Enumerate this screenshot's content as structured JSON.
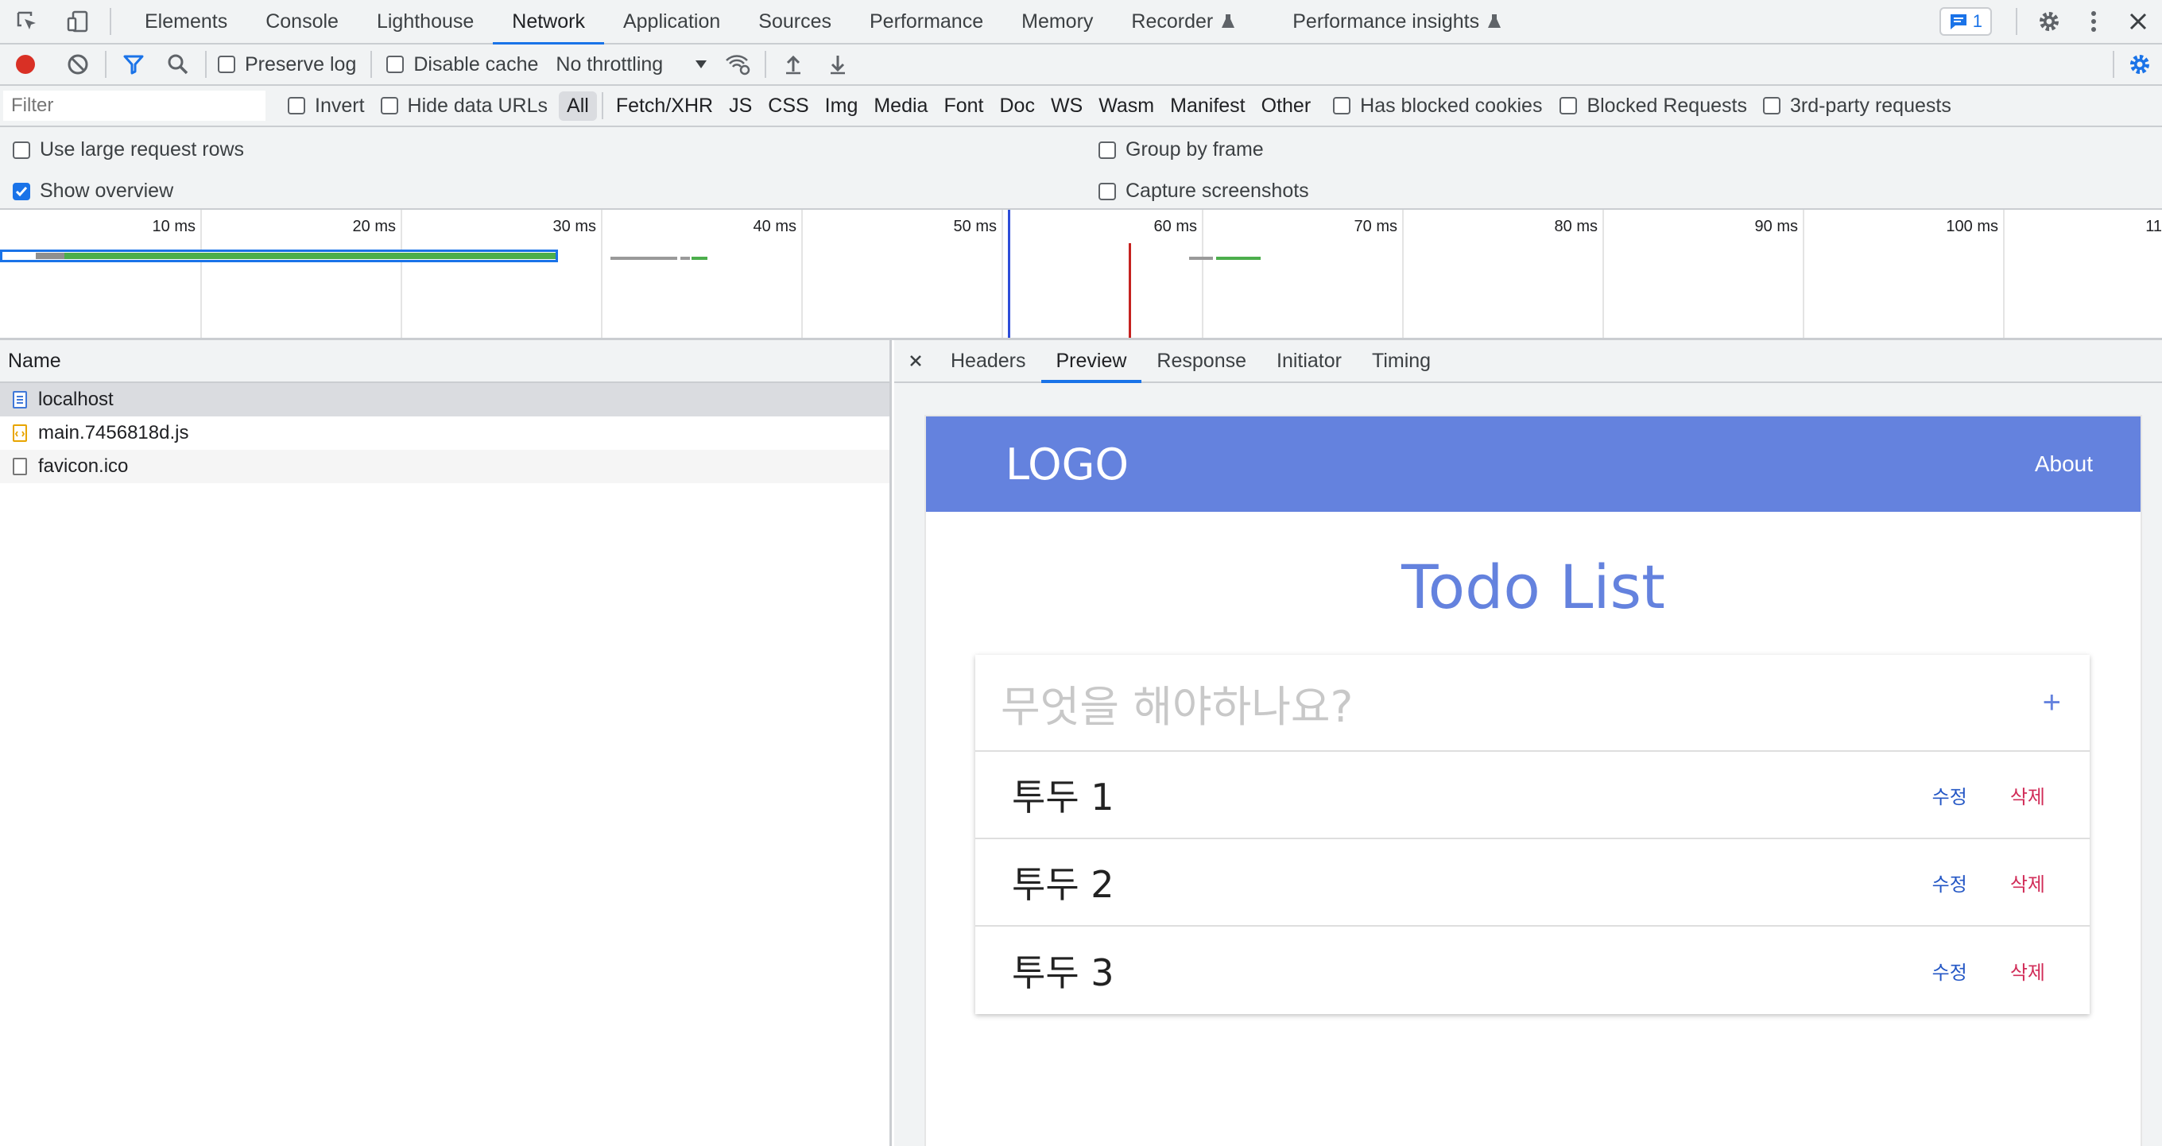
{
  "topbar": {
    "tabs": [
      "Elements",
      "Console",
      "Lighthouse",
      "Network",
      "Application",
      "Sources",
      "Performance",
      "Memory",
      "Recorder",
      "Performance insights"
    ],
    "active_tab": "Network",
    "issues_count": "1"
  },
  "toolbar": {
    "preserve_log": "Preserve log",
    "disable_cache": "Disable cache",
    "throttling": "No throttling"
  },
  "filterbar": {
    "placeholder": "Filter",
    "invert": "Invert",
    "hide_data_urls": "Hide data URLs",
    "types": [
      "All",
      "Fetch/XHR",
      "JS",
      "CSS",
      "Img",
      "Media",
      "Font",
      "Doc",
      "WS",
      "Wasm",
      "Manifest",
      "Other"
    ],
    "selected_type": "All",
    "blocked_cookies": "Has blocked cookies",
    "blocked_requests": "Blocked Requests",
    "third_party": "3rd-party requests"
  },
  "settings": {
    "large_rows": "Use large request rows",
    "show_overview": "Show overview",
    "group_by_frame": "Group by frame",
    "capture_screenshots": "Capture screenshots"
  },
  "overview": {
    "ticks": [
      "10 ms",
      "20 ms",
      "30 ms",
      "40 ms",
      "50 ms",
      "60 ms",
      "70 ms",
      "80 ms",
      "90 ms",
      "100 ms",
      "11"
    ]
  },
  "requests": {
    "header": "Name",
    "rows": [
      {
        "name": "localhost",
        "type": "document"
      },
      {
        "name": "main.7456818d.js",
        "type": "script"
      },
      {
        "name": "favicon.ico",
        "type": "other"
      }
    ]
  },
  "details": {
    "tabs": [
      "Headers",
      "Preview",
      "Response",
      "Initiator",
      "Timing"
    ],
    "active_tab": "Preview"
  },
  "app": {
    "logo": "LOGO",
    "nav_about": "About",
    "title": "Todo List",
    "input_placeholder": "무엇을 해야하나요?",
    "add_button": "+",
    "todos": [
      {
        "text": "투두 1",
        "edit": "수정",
        "delete": "삭제"
      },
      {
        "text": "투두 2",
        "edit": "수정",
        "delete": "삭제"
      },
      {
        "text": "투두 3",
        "edit": "수정",
        "delete": "삭제"
      }
    ],
    "accent_color": "#6482de"
  },
  "colors": {
    "devtools_accent": "#1a73e8",
    "record_red": "#d93025"
  }
}
